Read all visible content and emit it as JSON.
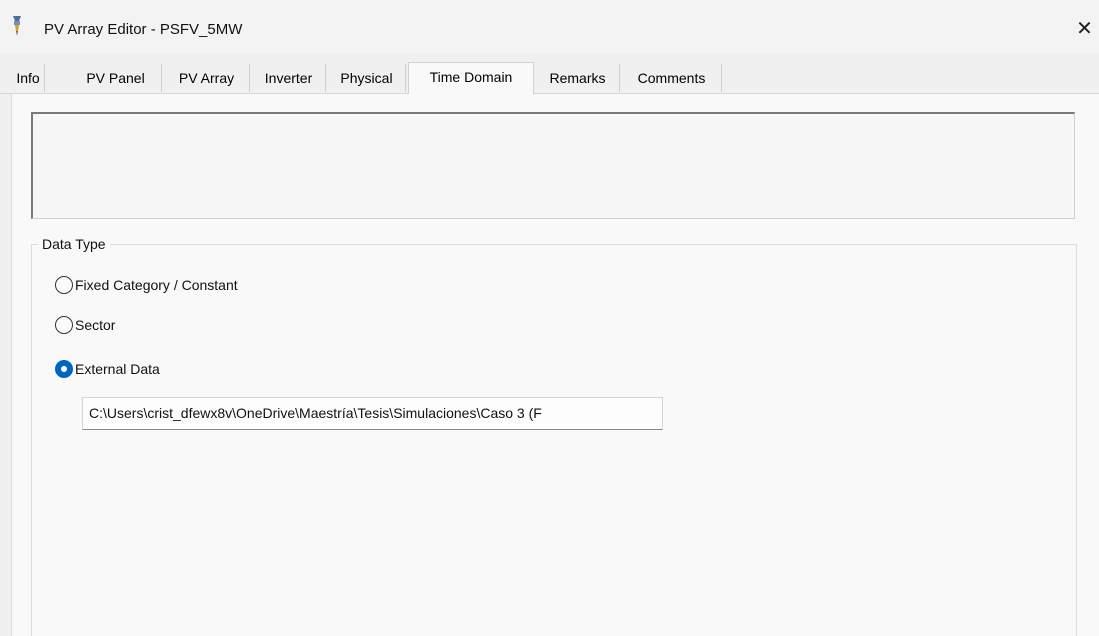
{
  "window": {
    "title": "PV Array Editor - PSFV_5MW",
    "close_label": "✕"
  },
  "tabs": [
    {
      "label": "Info"
    },
    {
      "label": "PV Panel"
    },
    {
      "label": "PV Array"
    },
    {
      "label": "Inverter"
    },
    {
      "label": "Physical"
    },
    {
      "label": "Time Domain"
    },
    {
      "label": "Remarks"
    },
    {
      "label": "Comments"
    }
  ],
  "active_tab": "Time Domain",
  "description_box": {
    "value": ""
  },
  "data_type": {
    "legend": "Data Type",
    "options": [
      {
        "label": "Fixed Category / Constant",
        "checked": false
      },
      {
        "label": "Sector",
        "checked": false
      },
      {
        "label": "External Data",
        "checked": true
      }
    ],
    "external_path": "C:\\Users\\crist_dfewx8v\\OneDrive\\Maestría\\Tesis\\Simulaciones\\Caso 3 (F"
  },
  "colors": {
    "accent": "#0067c0",
    "window_bg": "#f0f0f0",
    "panel_bg": "#f9f9f9"
  },
  "icons": {
    "app": "pv-array-editor-icon",
    "close": "close-icon"
  }
}
